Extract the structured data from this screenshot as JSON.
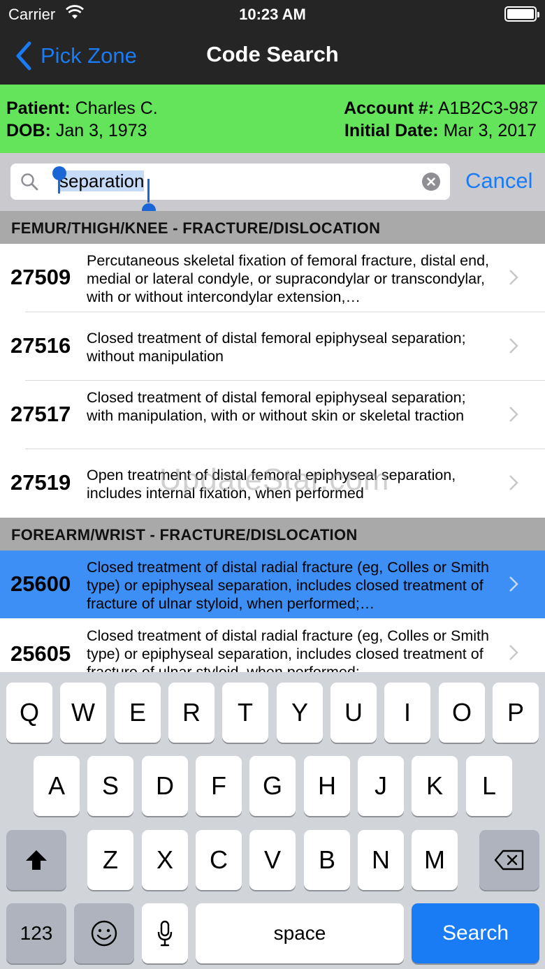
{
  "status": {
    "carrier": "Carrier",
    "time": "10:23 AM"
  },
  "nav": {
    "back_label": "Pick Zone",
    "title": "Code Search"
  },
  "patient": {
    "patient_label": "Patient:",
    "patient_value": "Charles C.",
    "dob_label": "DOB:",
    "dob_value": "Jan 3, 1973",
    "account_label": "Account #:",
    "account_value": "A1B2C3-987",
    "initial_label": "Initial Date:",
    "initial_value": "Mar 3, 2017"
  },
  "search": {
    "value": "separation",
    "cancel_label": "Cancel"
  },
  "sections": [
    {
      "header": "FEMUR/THIGH/KNEE - FRACTURE/DISLOCATION",
      "items": [
        {
          "code": "27509",
          "description": "Percutaneous skeletal fixation of femoral fracture, distal end, medial or lateral condyle, or supracondylar or transcondylar, with or without intercondylar extension,…"
        },
        {
          "code": "27516",
          "description": "Closed treatment of distal femoral epiphyseal separation; without manipulation"
        },
        {
          "code": "27517",
          "description": "Closed treatment of distal femoral epiphyseal separation; with manipulation, with or without skin or skeletal traction"
        },
        {
          "code": "27519",
          "description": "Open treatment of distal femoral epiphyseal separation, includes internal fixation, when performed"
        }
      ]
    },
    {
      "header": "FOREARM/WRIST - FRACTURE/DISLOCATION",
      "items": [
        {
          "code": "25600",
          "description": "Closed treatment of distal radial fracture (eg, Colles or Smith type) or epiphyseal separation, includes closed treatment of fracture of ulnar styloid, when performed;…"
        },
        {
          "code": "25605",
          "description": "Closed treatment of distal radial fracture (eg, Colles or Smith type) or epiphyseal separation, includes closed treatment of fracture of ulnar styloid, when performed;"
        }
      ]
    }
  ],
  "watermark": "UpdateStar.com",
  "keyboard": {
    "row1": [
      "Q",
      "W",
      "E",
      "R",
      "T",
      "Y",
      "U",
      "I",
      "O",
      "P"
    ],
    "row2": [
      "A",
      "S",
      "D",
      "F",
      "G",
      "H",
      "J",
      "K",
      "L"
    ],
    "row3": [
      "Z",
      "X",
      "C",
      "V",
      "B",
      "N",
      "M"
    ],
    "numbers_label": "123",
    "space_label": "space",
    "search_label": "Search"
  }
}
